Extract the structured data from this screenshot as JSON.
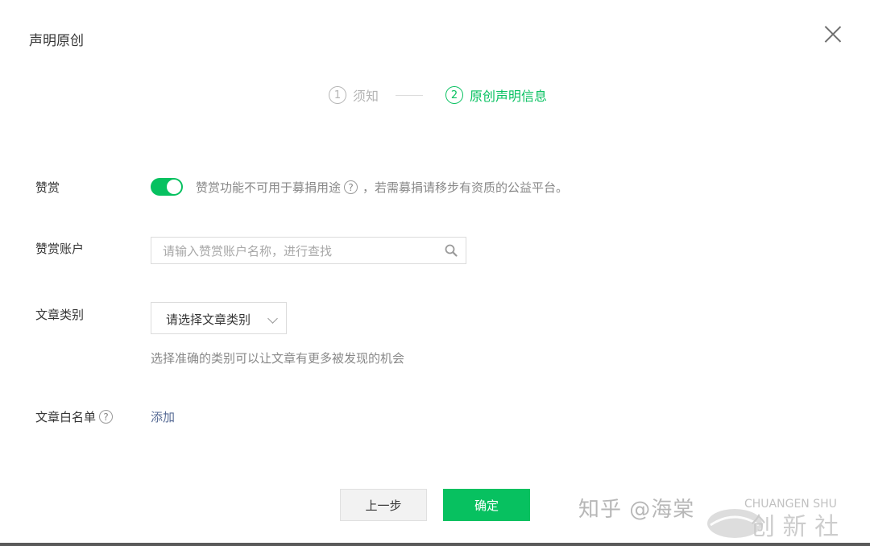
{
  "dialog": {
    "title": "声明原创"
  },
  "steps": [
    {
      "number": "1",
      "label": "须知",
      "state": "done"
    },
    {
      "number": "2",
      "label": "原创声明信息",
      "state": "active"
    }
  ],
  "reward": {
    "label": "赞赏",
    "enabled": true,
    "tip_before": "赞赏功能不可用于募捐用途",
    "tip_after": "，若需募捐请移步有资质的公益平台。"
  },
  "reward_account": {
    "label": "赞赏账户",
    "placeholder": "请输入赞赏账户名称，进行查找"
  },
  "category": {
    "label": "文章类别",
    "selected": "请选择文章类别",
    "hint": "选择准确的类别可以让文章有更多被发现的机会"
  },
  "whitelist": {
    "label": "文章白名单",
    "add_link": "添加"
  },
  "buttons": {
    "prev": "上一步",
    "confirm": "确定"
  },
  "watermark": {
    "text": "知乎 @海棠",
    "brand": "CHUANGEN SHU"
  },
  "colors": {
    "accent": "#07c160",
    "link": "#576b95",
    "muted": "#888888"
  }
}
